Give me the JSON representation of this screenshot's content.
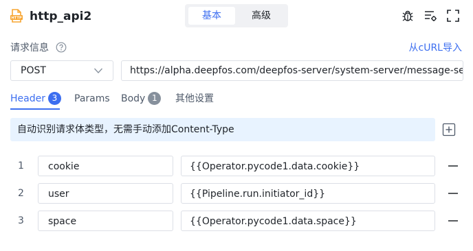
{
  "app": {
    "title": "http_api2",
    "icon": "http-icon",
    "mode_tabs": [
      {
        "label": "基本",
        "active": true
      },
      {
        "label": "高级",
        "active": false
      }
    ],
    "toolbar_icons": [
      "debug-icon",
      "list-settings-icon",
      "fullscreen-icon"
    ]
  },
  "request": {
    "section_label": "请求信息",
    "help_icon": "question-circle-icon",
    "curl_import_label": "从cURL导入",
    "method": "POST",
    "url": "https://alpha.deepfos.com/deepfos-server/system-server/message-service/"
  },
  "tabs": [
    {
      "label": "Header",
      "badge": "3",
      "active": true
    },
    {
      "label": "Params",
      "badge": "",
      "active": false
    },
    {
      "label": "Body",
      "badge": "1",
      "active": false
    },
    {
      "label": "其他设置",
      "badge": "",
      "active": false
    }
  ],
  "info_text": "自动识别请求体类型，无需手动添加Content-Type",
  "headers": [
    {
      "num": "1",
      "key": "cookie",
      "value": "{{Operator.pycode1.data.cookie}}"
    },
    {
      "num": "2",
      "key": "user",
      "value": "{{Pipeline.run.initiator_id}}"
    },
    {
      "num": "3",
      "key": "space",
      "value": "{{Operator.pycode1.data.space}}"
    }
  ],
  "colors": {
    "accent": "#3c6ef0",
    "info_bg": "#e8f3ff",
    "badge_inactive": "#86909c",
    "icon_orange": "#f7a531"
  }
}
